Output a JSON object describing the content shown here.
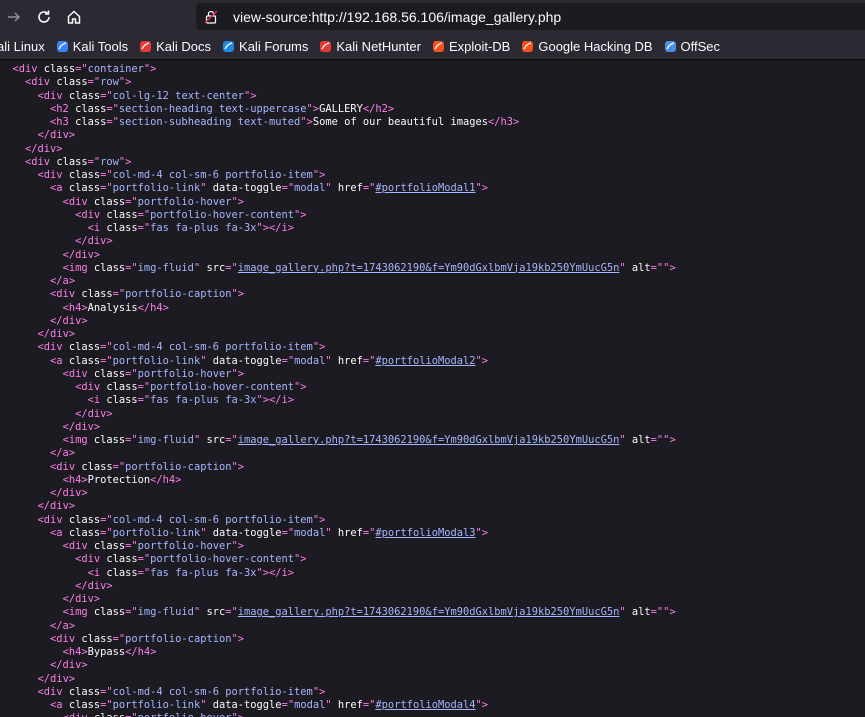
{
  "browser": {
    "url": "view-source:http://192.168.56.106/image_gallery.php",
    "nav": {
      "back_icon": "arrow-right-icon",
      "reload_icon": "reload-icon",
      "home_icon": "home-icon"
    }
  },
  "bookmarks": [
    {
      "label": "ali Linux",
      "icon": "kali-icon",
      "color": "#3b82f6"
    },
    {
      "label": "Kali Tools",
      "icon": "kali-tools-icon",
      "color": "#3b82f6"
    },
    {
      "label": "Kali Docs",
      "icon": "kali-docs-icon",
      "color": "#e53935"
    },
    {
      "label": "Kali Forums",
      "icon": "kali-forums-icon",
      "color": "#1e88e5"
    },
    {
      "label": "Kali NetHunter",
      "icon": "nethunter-icon",
      "color": "#e53935"
    },
    {
      "label": "Exploit-DB",
      "icon": "exploit-db-icon",
      "color": "#f4511e"
    },
    {
      "label": "Google Hacking DB",
      "icon": "ghdb-icon",
      "color": "#f4511e"
    },
    {
      "label": "OffSec",
      "icon": "offsec-icon",
      "color": "#4a90e2"
    }
  ],
  "colors": {
    "tag": "#ff7de9",
    "attr": "#fbfbfe",
    "value": "#a6b5ff",
    "background": "#1c1b22"
  },
  "source_lines": [
    [
      [
        "  ",
        "t"
      ],
      [
        "<div ",
        "tag"
      ],
      [
        "class",
        "attr"
      ],
      [
        "=\"",
        "tag"
      ],
      [
        "container",
        "val"
      ],
      [
        "\">",
        "tag"
      ]
    ],
    [
      [
        "    ",
        "t"
      ],
      [
        "<div ",
        "tag"
      ],
      [
        "class",
        "attr"
      ],
      [
        "=\"",
        "tag"
      ],
      [
        "row",
        "val"
      ],
      [
        "\">",
        "tag"
      ]
    ],
    [
      [
        "      ",
        "t"
      ],
      [
        "<div ",
        "tag"
      ],
      [
        "class",
        "attr"
      ],
      [
        "=\"",
        "tag"
      ],
      [
        "col-lg-12 text-center",
        "val"
      ],
      [
        "\">",
        "tag"
      ]
    ],
    [
      [
        "        ",
        "t"
      ],
      [
        "<h2 ",
        "tag"
      ],
      [
        "class",
        "attr"
      ],
      [
        "=\"",
        "tag"
      ],
      [
        "section-heading text-uppercase",
        "val"
      ],
      [
        "\">",
        "tag"
      ],
      [
        "GALLERY",
        "t"
      ],
      [
        "</h2>",
        "tag"
      ]
    ],
    [
      [
        "        ",
        "t"
      ],
      [
        "<h3 ",
        "tag"
      ],
      [
        "class",
        "attr"
      ],
      [
        "=\"",
        "tag"
      ],
      [
        "section-subheading text-muted",
        "val"
      ],
      [
        "\">",
        "tag"
      ],
      [
        "Some of our beautiful images",
        "t"
      ],
      [
        "</h3>",
        "tag"
      ]
    ],
    [
      [
        "      ",
        "t"
      ],
      [
        "</div>",
        "tag"
      ]
    ],
    [
      [
        "    ",
        "t"
      ],
      [
        "</div>",
        "tag"
      ]
    ],
    [
      [
        "    ",
        "t"
      ],
      [
        "<div ",
        "tag"
      ],
      [
        "class",
        "attr"
      ],
      [
        "=\"",
        "tag"
      ],
      [
        "row",
        "val"
      ],
      [
        "\">",
        "tag"
      ]
    ],
    [
      [
        "      ",
        "t"
      ],
      [
        "<div ",
        "tag"
      ],
      [
        "class",
        "attr"
      ],
      [
        "=\"",
        "tag"
      ],
      [
        "col-md-4 col-sm-6 portfolio-item",
        "val"
      ],
      [
        "\">",
        "tag"
      ]
    ],
    [
      [
        "        ",
        "t"
      ],
      [
        "<a ",
        "tag"
      ],
      [
        "class",
        "attr"
      ],
      [
        "=\"",
        "tag"
      ],
      [
        "portfolio-link",
        "val"
      ],
      [
        "\" ",
        "tag"
      ],
      [
        "data-toggle",
        "attr"
      ],
      [
        "=\"",
        "tag"
      ],
      [
        "modal",
        "val"
      ],
      [
        "\" ",
        "tag"
      ],
      [
        "href",
        "attr"
      ],
      [
        "=\"",
        "tag"
      ],
      [
        "#portfolioModal1",
        "link"
      ],
      [
        "\">",
        "tag"
      ]
    ],
    [
      [
        "          ",
        "t"
      ],
      [
        "<div ",
        "tag"
      ],
      [
        "class",
        "attr"
      ],
      [
        "=\"",
        "tag"
      ],
      [
        "portfolio-hover",
        "val"
      ],
      [
        "\">",
        "tag"
      ]
    ],
    [
      [
        "            ",
        "t"
      ],
      [
        "<div ",
        "tag"
      ],
      [
        "class",
        "attr"
      ],
      [
        "=\"",
        "tag"
      ],
      [
        "portfolio-hover-content",
        "val"
      ],
      [
        "\">",
        "tag"
      ]
    ],
    [
      [
        "              ",
        "t"
      ],
      [
        "<i ",
        "tag"
      ],
      [
        "class",
        "attr"
      ],
      [
        "=\"",
        "tag"
      ],
      [
        "fas fa-plus fa-3x",
        "val"
      ],
      [
        "\"></i>",
        "tag"
      ]
    ],
    [
      [
        "            ",
        "t"
      ],
      [
        "</div>",
        "tag"
      ]
    ],
    [
      [
        "          ",
        "t"
      ],
      [
        "</div>",
        "tag"
      ]
    ],
    [
      [
        "          ",
        "t"
      ],
      [
        "<img ",
        "tag"
      ],
      [
        "class",
        "attr"
      ],
      [
        "=\"",
        "tag"
      ],
      [
        "img-fluid",
        "val"
      ],
      [
        "\" ",
        "tag"
      ],
      [
        "src",
        "attr"
      ],
      [
        "=\"",
        "tag"
      ],
      [
        "image_gallery.php?t=1743062190&f=Ym90dGxlbmVja19kb250YmUucG5n",
        "link"
      ],
      [
        "\" ",
        "tag"
      ],
      [
        "alt",
        "attr"
      ],
      [
        "=\"\">",
        "tag"
      ]
    ],
    [
      [
        "        ",
        "t"
      ],
      [
        "</a>",
        "tag"
      ]
    ],
    [
      [
        "        ",
        "t"
      ],
      [
        "<div ",
        "tag"
      ],
      [
        "class",
        "attr"
      ],
      [
        "=\"",
        "tag"
      ],
      [
        "portfolio-caption",
        "val"
      ],
      [
        "\">",
        "tag"
      ]
    ],
    [
      [
        "          ",
        "t"
      ],
      [
        "<h4>",
        "tag"
      ],
      [
        "Analysis",
        "t"
      ],
      [
        "</h4>",
        "tag"
      ]
    ],
    [
      [
        "        ",
        "t"
      ],
      [
        "</div>",
        "tag"
      ]
    ],
    [
      [
        "      ",
        "t"
      ],
      [
        "</div>",
        "tag"
      ]
    ],
    [
      [
        "      ",
        "t"
      ],
      [
        "<div ",
        "tag"
      ],
      [
        "class",
        "attr"
      ],
      [
        "=\"",
        "tag"
      ],
      [
        "col-md-4 col-sm-6 portfolio-item",
        "val"
      ],
      [
        "\">",
        "tag"
      ]
    ],
    [
      [
        "        ",
        "t"
      ],
      [
        "<a ",
        "tag"
      ],
      [
        "class",
        "attr"
      ],
      [
        "=\"",
        "tag"
      ],
      [
        "portfolio-link",
        "val"
      ],
      [
        "\" ",
        "tag"
      ],
      [
        "data-toggle",
        "attr"
      ],
      [
        "=\"",
        "tag"
      ],
      [
        "modal",
        "val"
      ],
      [
        "\" ",
        "tag"
      ],
      [
        "href",
        "attr"
      ],
      [
        "=\"",
        "tag"
      ],
      [
        "#portfolioModal2",
        "link"
      ],
      [
        "\">",
        "tag"
      ]
    ],
    [
      [
        "          ",
        "t"
      ],
      [
        "<div ",
        "tag"
      ],
      [
        "class",
        "attr"
      ],
      [
        "=\"",
        "tag"
      ],
      [
        "portfolio-hover",
        "val"
      ],
      [
        "\">",
        "tag"
      ]
    ],
    [
      [
        "            ",
        "t"
      ],
      [
        "<div ",
        "tag"
      ],
      [
        "class",
        "attr"
      ],
      [
        "=\"",
        "tag"
      ],
      [
        "portfolio-hover-content",
        "val"
      ],
      [
        "\">",
        "tag"
      ]
    ],
    [
      [
        "              ",
        "t"
      ],
      [
        "<i ",
        "tag"
      ],
      [
        "class",
        "attr"
      ],
      [
        "=\"",
        "tag"
      ],
      [
        "fas fa-plus fa-3x",
        "val"
      ],
      [
        "\"></i>",
        "tag"
      ]
    ],
    [
      [
        "            ",
        "t"
      ],
      [
        "</div>",
        "tag"
      ]
    ],
    [
      [
        "          ",
        "t"
      ],
      [
        "</div>",
        "tag"
      ]
    ],
    [
      [
        "          ",
        "t"
      ],
      [
        "<img ",
        "tag"
      ],
      [
        "class",
        "attr"
      ],
      [
        "=\"",
        "tag"
      ],
      [
        "img-fluid",
        "val"
      ],
      [
        "\" ",
        "tag"
      ],
      [
        "src",
        "attr"
      ],
      [
        "=\"",
        "tag"
      ],
      [
        "image_gallery.php?t=1743062190&f=Ym90dGxlbmVja19kb250YmUucG5n",
        "link"
      ],
      [
        "\" ",
        "tag"
      ],
      [
        "alt",
        "attr"
      ],
      [
        "=\"\">",
        "tag"
      ]
    ],
    [
      [
        "        ",
        "t"
      ],
      [
        "</a>",
        "tag"
      ]
    ],
    [
      [
        "        ",
        "t"
      ],
      [
        "<div ",
        "tag"
      ],
      [
        "class",
        "attr"
      ],
      [
        "=\"",
        "tag"
      ],
      [
        "portfolio-caption",
        "val"
      ],
      [
        "\">",
        "tag"
      ]
    ],
    [
      [
        "          ",
        "t"
      ],
      [
        "<h4>",
        "tag"
      ],
      [
        "Protection",
        "t"
      ],
      [
        "</h4>",
        "tag"
      ]
    ],
    [
      [
        "        ",
        "t"
      ],
      [
        "</div>",
        "tag"
      ]
    ],
    [
      [
        "      ",
        "t"
      ],
      [
        "</div>",
        "tag"
      ]
    ],
    [
      [
        "      ",
        "t"
      ],
      [
        "<div ",
        "tag"
      ],
      [
        "class",
        "attr"
      ],
      [
        "=\"",
        "tag"
      ],
      [
        "col-md-4 col-sm-6 portfolio-item",
        "val"
      ],
      [
        "\">",
        "tag"
      ]
    ],
    [
      [
        "        ",
        "t"
      ],
      [
        "<a ",
        "tag"
      ],
      [
        "class",
        "attr"
      ],
      [
        "=\"",
        "tag"
      ],
      [
        "portfolio-link",
        "val"
      ],
      [
        "\" ",
        "tag"
      ],
      [
        "data-toggle",
        "attr"
      ],
      [
        "=\"",
        "tag"
      ],
      [
        "modal",
        "val"
      ],
      [
        "\" ",
        "tag"
      ],
      [
        "href",
        "attr"
      ],
      [
        "=\"",
        "tag"
      ],
      [
        "#portfolioModal3",
        "link"
      ],
      [
        "\">",
        "tag"
      ]
    ],
    [
      [
        "          ",
        "t"
      ],
      [
        "<div ",
        "tag"
      ],
      [
        "class",
        "attr"
      ],
      [
        "=\"",
        "tag"
      ],
      [
        "portfolio-hover",
        "val"
      ],
      [
        "\">",
        "tag"
      ]
    ],
    [
      [
        "            ",
        "t"
      ],
      [
        "<div ",
        "tag"
      ],
      [
        "class",
        "attr"
      ],
      [
        "=\"",
        "tag"
      ],
      [
        "portfolio-hover-content",
        "val"
      ],
      [
        "\">",
        "tag"
      ]
    ],
    [
      [
        "              ",
        "t"
      ],
      [
        "<i ",
        "tag"
      ],
      [
        "class",
        "attr"
      ],
      [
        "=\"",
        "tag"
      ],
      [
        "fas fa-plus fa-3x",
        "val"
      ],
      [
        "\"></i>",
        "tag"
      ]
    ],
    [
      [
        "            ",
        "t"
      ],
      [
        "</div>",
        "tag"
      ]
    ],
    [
      [
        "          ",
        "t"
      ],
      [
        "</div>",
        "tag"
      ]
    ],
    [
      [
        "          ",
        "t"
      ],
      [
        "<img ",
        "tag"
      ],
      [
        "class",
        "attr"
      ],
      [
        "=\"",
        "tag"
      ],
      [
        "img-fluid",
        "val"
      ],
      [
        "\" ",
        "tag"
      ],
      [
        "src",
        "attr"
      ],
      [
        "=\"",
        "tag"
      ],
      [
        "image_gallery.php?t=1743062190&f=Ym90dGxlbmVja19kb250YmUucG5n",
        "link"
      ],
      [
        "\" ",
        "tag"
      ],
      [
        "alt",
        "attr"
      ],
      [
        "=\"\">",
        "tag"
      ]
    ],
    [
      [
        "        ",
        "t"
      ],
      [
        "</a>",
        "tag"
      ]
    ],
    [
      [
        "        ",
        "t"
      ],
      [
        "<div ",
        "tag"
      ],
      [
        "class",
        "attr"
      ],
      [
        "=\"",
        "tag"
      ],
      [
        "portfolio-caption",
        "val"
      ],
      [
        "\">",
        "tag"
      ]
    ],
    [
      [
        "          ",
        "t"
      ],
      [
        "<h4>",
        "tag"
      ],
      [
        "Bypass",
        "t"
      ],
      [
        "</h4>",
        "tag"
      ]
    ],
    [
      [
        "        ",
        "t"
      ],
      [
        "</div>",
        "tag"
      ]
    ],
    [
      [
        "      ",
        "t"
      ],
      [
        "</div>",
        "tag"
      ]
    ],
    [
      [
        "      ",
        "t"
      ],
      [
        "<div ",
        "tag"
      ],
      [
        "class",
        "attr"
      ],
      [
        "=\"",
        "tag"
      ],
      [
        "col-md-4 col-sm-6 portfolio-item",
        "val"
      ],
      [
        "\">",
        "tag"
      ]
    ],
    [
      [
        "        ",
        "t"
      ],
      [
        "<a ",
        "tag"
      ],
      [
        "class",
        "attr"
      ],
      [
        "=\"",
        "tag"
      ],
      [
        "portfolio-link",
        "val"
      ],
      [
        "\" ",
        "tag"
      ],
      [
        "data-toggle",
        "attr"
      ],
      [
        "=\"",
        "tag"
      ],
      [
        "modal",
        "val"
      ],
      [
        "\" ",
        "tag"
      ],
      [
        "href",
        "attr"
      ],
      [
        "=\"",
        "tag"
      ],
      [
        "#portfolioModal4",
        "link"
      ],
      [
        "\">",
        "tag"
      ]
    ],
    [
      [
        "          ",
        "t"
      ],
      [
        "<div ",
        "tag"
      ],
      [
        "class",
        "attr"
      ],
      [
        "=\"",
        "tag"
      ],
      [
        "portfolio-hover",
        "val"
      ],
      [
        "\">",
        "tag"
      ]
    ]
  ]
}
